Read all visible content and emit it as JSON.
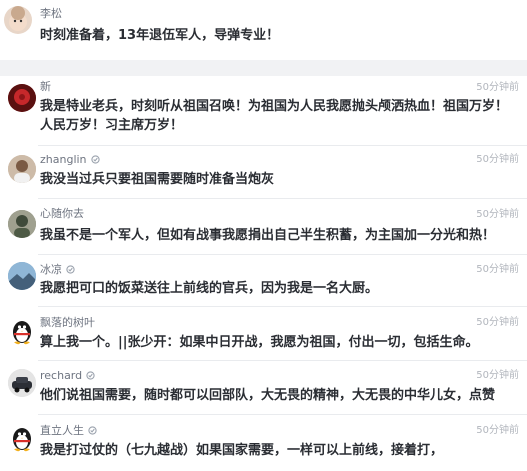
{
  "comments": [
    {
      "user": "李松",
      "text": "时刻准备着，13年退伍军人，导弹专业！",
      "time": "",
      "verified": false,
      "avatar": "baby-avatar"
    },
    {
      "user": "新",
      "text": "我是特业老兵，时刻听从祖国召唤！为祖国为人民我愿抛头颅洒热血！祖国万岁！人民万岁！习主席万岁！",
      "time": "50分钟前",
      "verified": false,
      "avatar": "red-flower-avatar"
    },
    {
      "user": "zhanglin",
      "text": "我没当过兵只要祖国需要随时准备当炮灰",
      "time": "50分钟前",
      "verified": true,
      "avatar": "person-avatar"
    },
    {
      "user": "心随你去",
      "text": "我虽不是一个军人，但如有战事我愿捐出自己半生积蓄，为主国加一分光和热！",
      "time": "50分钟前",
      "verified": false,
      "avatar": "soldier-avatar"
    },
    {
      "user": "冰凉",
      "text": "我愿把可口的饭菜送往上前线的官兵，因为我是一名大厨。",
      "time": "50分钟前",
      "verified": true,
      "avatar": "scenery-avatar"
    },
    {
      "user": "飘落的树叶",
      "text": "算上我一个。||张少开：如果中日开战，我愿为祖国，付出一切，包括生命。",
      "time": "50分钟前",
      "verified": false,
      "avatar": "qq-penguin-avatar"
    },
    {
      "user": "rechard",
      "text": "他们说祖国需要，随时都可以回部队，大无畏的精神，大无畏的中华儿女，点赞",
      "time": "50分钟前",
      "verified": true,
      "avatar": "car-avatar"
    },
    {
      "user": "直立人生",
      "text": "我是打过仗的（七九越战）如果国家需要，一样可以上前线，接着打，",
      "time": "50分钟前",
      "verified": true,
      "avatar": "qq-penguin-avatar"
    }
  ]
}
